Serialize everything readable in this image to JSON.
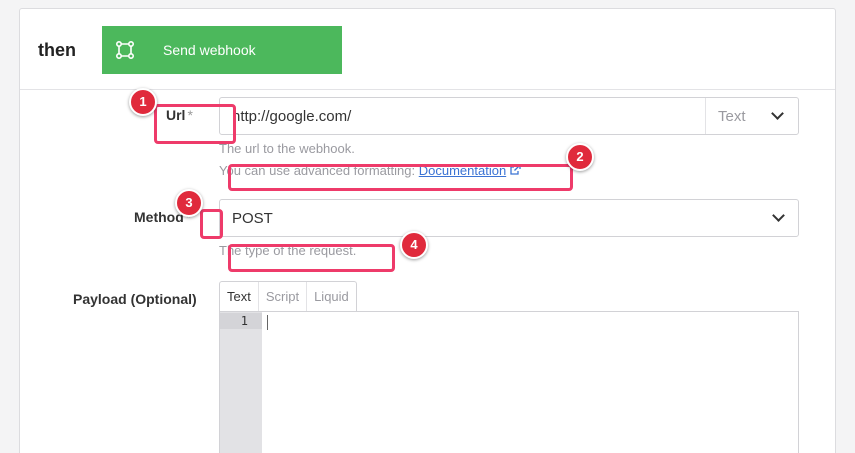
{
  "header": {
    "then_label": "then",
    "action": {
      "label": "Send webhook",
      "icon": "webhook-icon",
      "color": "#4cb85c"
    }
  },
  "url_field": {
    "label": "Url",
    "required_mark": "*",
    "value": "http://google.com/",
    "type_select": "Text",
    "help_line1": "The url to the webhook.",
    "help_line2_prefix": "You can use advanced formatting:",
    "help_link": "Documentation"
  },
  "method_field": {
    "label": "Method",
    "required_mark": "*",
    "value": "POST",
    "help": "The type of the request."
  },
  "payload_field": {
    "label": "Payload (Optional)",
    "tabs": [
      "Text",
      "Script",
      "Liquid"
    ],
    "active_tab": "Text",
    "line_number": "1"
  },
  "annotations": {
    "color": "#ee3b6a",
    "badge_color": "#e02a3c",
    "badges": [
      "1",
      "2",
      "3",
      "4"
    ]
  }
}
